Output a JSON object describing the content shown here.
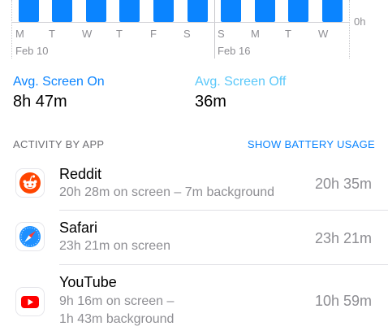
{
  "chart": {
    "day_labels": [
      "M",
      "T",
      "W",
      "T",
      "F",
      "S",
      "S",
      "M",
      "T",
      "W"
    ],
    "week_labels": [
      "Feb 10",
      "Feb 16"
    ],
    "axis_zero_label": "0h"
  },
  "averages": {
    "screen_on_title": "Avg. Screen On",
    "screen_on_value": "8h 47m",
    "screen_off_title": "Avg. Screen Off",
    "screen_off_value": "36m"
  },
  "activity": {
    "header": "ACTIVITY BY APP",
    "action_label": "SHOW BATTERY USAGE",
    "apps": [
      {
        "name": "Reddit",
        "detail_line1": "20h 28m on screen – 7m background",
        "detail_line2": "",
        "total": "20h 35m",
        "icon": "reddit-icon"
      },
      {
        "name": "Safari",
        "detail_line1": "23h 21m on screen",
        "detail_line2": "",
        "total": "23h 21m",
        "icon": "safari-icon"
      },
      {
        "name": "YouTube",
        "detail_line1": "9h 16m on screen –",
        "detail_line2": "1h 43m background",
        "total": "10h 59m",
        "icon": "youtube-icon"
      }
    ]
  },
  "colors": {
    "screen_on": "#0a84ff",
    "screen_off": "#5ac8fa",
    "secondary_text": "#8e8e93",
    "reddit": "#ff4500",
    "youtube": "#ff0000"
  }
}
